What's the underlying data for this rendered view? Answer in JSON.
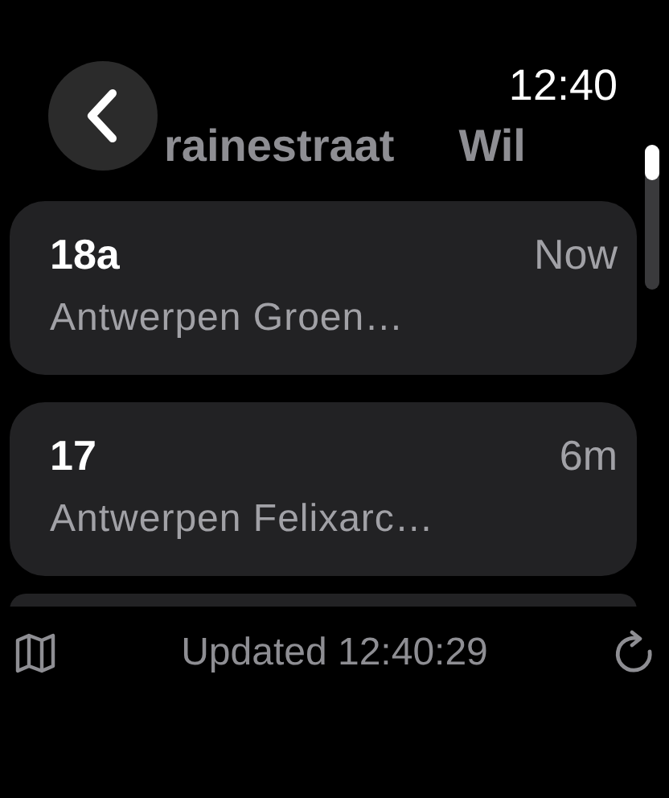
{
  "clock": "12:40",
  "header_tabs": [
    {
      "label": "rainestraat"
    },
    {
      "label": "Wil"
    }
  ],
  "departures": [
    {
      "line": "18a",
      "time": "Now",
      "destination": "Antwerpen Groen…"
    },
    {
      "line": "17",
      "time": "6m",
      "destination": "Antwerpen Felixarc…"
    }
  ],
  "status_text": "Updated 12:40:29"
}
